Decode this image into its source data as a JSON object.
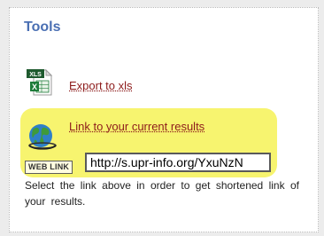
{
  "panel": {
    "title": "Tools"
  },
  "export": {
    "icon_label": "XLS",
    "link_text": "Export to xls"
  },
  "results": {
    "link_text": "Link to your current results",
    "badge_text": "WEB LINK",
    "url_value": "http://s.upr-info.org/YxuNzN",
    "description": "Select the link above in order to get shortened link of your results."
  },
  "colors": {
    "title": "#4a6fb3",
    "link": "#8d1b1b",
    "highlight": "#f7f46f",
    "excel_green": "#1e7c3a"
  }
}
